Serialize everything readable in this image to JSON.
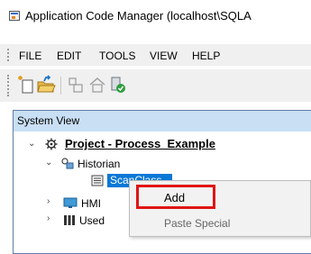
{
  "window": {
    "title": "Application Code Manager (localhost\\SQLA"
  },
  "menubar": {
    "items": [
      "FILE",
      "EDIT",
      "TOOLS",
      "VIEW",
      "HELP"
    ]
  },
  "panel": {
    "title": "System View"
  },
  "tree": {
    "project": "Project - Process_Example",
    "historian": "Historian",
    "selected_node": "ScanClass",
    "hmi": "HMI",
    "used": "Used"
  },
  "context_menu": {
    "items": [
      "Add",
      "Paste Special"
    ]
  },
  "colors": {
    "selection": "#0a78d7",
    "panel_header": "#c9dff4",
    "highlight_box": "#e01414"
  }
}
